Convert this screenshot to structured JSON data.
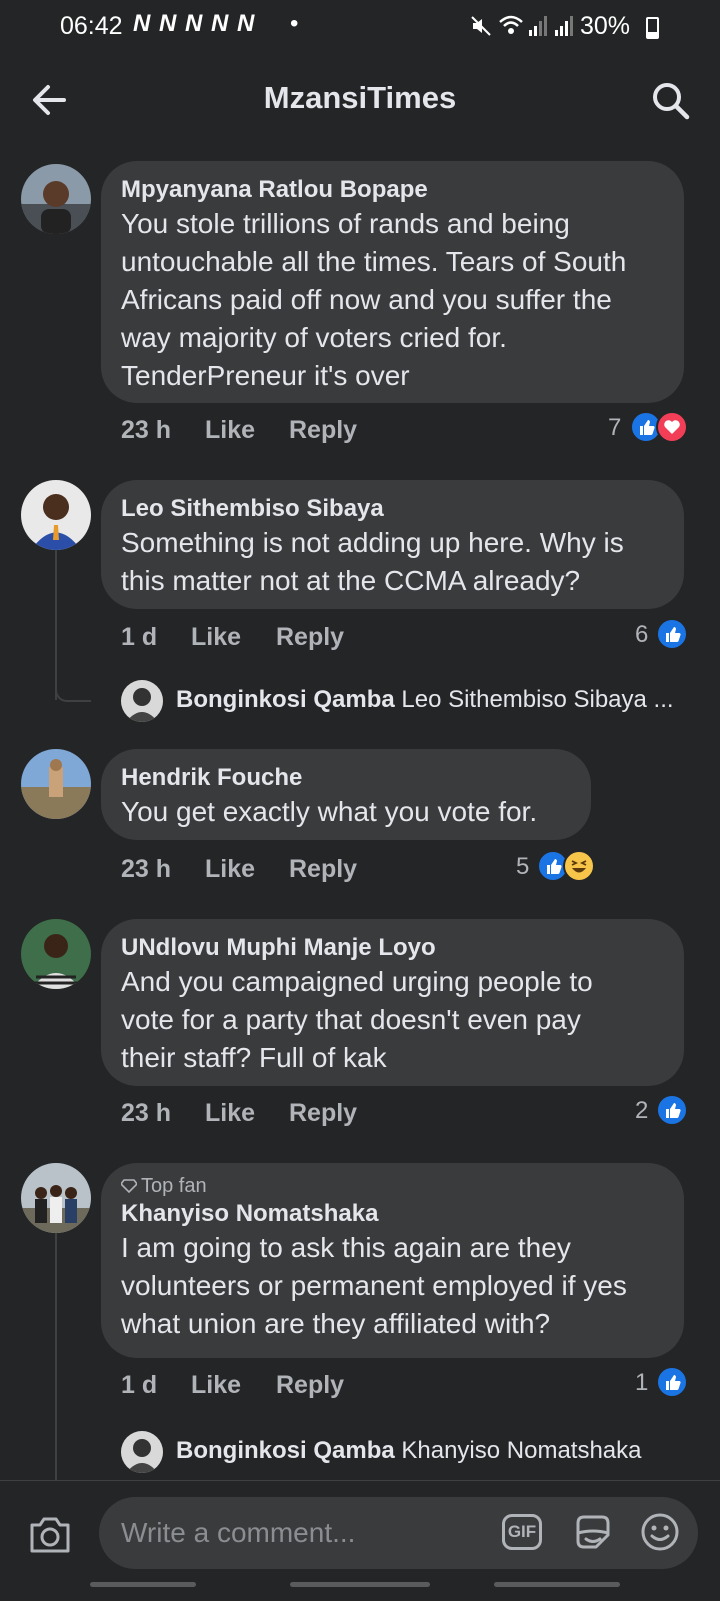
{
  "status_bar": {
    "time": "06:42",
    "notifications": "N N N N N",
    "dot": "•",
    "battery": "30%",
    "battery_level": 0.3,
    "icons": [
      "mute-icon",
      "wifi-icon",
      "signal-icon",
      "signal-icon"
    ]
  },
  "header": {
    "title": "MzansiTimes",
    "back_icon": "arrow-left-icon",
    "search_icon": "search-icon"
  },
  "comments": [
    {
      "author": "Mpyanyana Ratlou Bopape",
      "lines": [
        "You stole trillions of rands and being",
        "untouchable all the times. Tears of South",
        "Africans paid off now and you suffer the",
        "way majority of voters cried for.",
        "TenderPreneur it's over"
      ],
      "time": "23 h",
      "like": "Like",
      "reply": "Reply",
      "reaction_count": "7",
      "reactions": [
        "like",
        "love"
      ]
    },
    {
      "author": "Leo Sithembiso Sibaya",
      "lines": [
        "Something is not adding up here. Why is",
        "this matter not at the CCMA already?"
      ],
      "time": "1 d",
      "like": "Like",
      "reply": "Reply",
      "reaction_count": "6",
      "reactions": [
        "like"
      ],
      "reply_preview": {
        "author": "Bonginkosi Qamba",
        "text": "Leo Sithembiso Sibaya ..."
      }
    },
    {
      "author": "Hendrik Fouche",
      "lines": [
        "You get exactly what you vote for."
      ],
      "time": "23 h",
      "like": "Like",
      "reply": "Reply",
      "reaction_count": "5",
      "reactions": [
        "like",
        "haha"
      ]
    },
    {
      "author": "UNdlovu Muphi Manje Loyo",
      "lines": [
        "And you campaigned urging people to",
        "vote for a party that doesn't even pay",
        "their staff? Full of kak"
      ],
      "time": "23 h",
      "like": "Like",
      "reply": "Reply",
      "reaction_count": "2",
      "reactions": [
        "like"
      ]
    },
    {
      "badge": "Top fan",
      "author": "Khanyiso Nomatshaka",
      "lines": [
        "I am going to ask this again are they",
        "volunteers or permanent employed if yes",
        "what union are they affiliated with?"
      ],
      "time": "1 d",
      "like": "Like",
      "reply": "Reply",
      "reaction_count": "1",
      "reactions": [
        "like"
      ],
      "reply_preview": {
        "author": "Bonginkosi Qamba",
        "text": "Khanyiso Nomatshaka"
      }
    }
  ],
  "composer": {
    "placeholder": "Write a comment...",
    "gif": "GIF",
    "camera_icon": "camera-icon",
    "sticker_icon": "sticker-icon",
    "emoji_icon": "emoji-icon"
  },
  "colors": {
    "background": "#242526",
    "bubble": "#3a3b3c",
    "like_blue": "#1b74e4",
    "love_red": "#f33e58"
  }
}
